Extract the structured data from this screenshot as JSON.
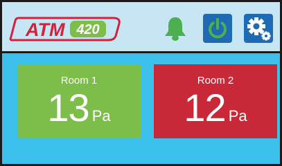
{
  "header": {
    "logo": {
      "brand": "ATM",
      "model": "420"
    },
    "buttons": [
      {
        "icon": "bell-icon",
        "color": "#4caf50"
      },
      {
        "icon": "power-icon",
        "color": "#1e6ab3"
      },
      {
        "icon": "gear-icon",
        "color": "#1e6ab3"
      }
    ]
  },
  "rooms": [
    {
      "name": "Room 1",
      "value": "13",
      "unit": "Pa",
      "color": "#7dbd4a"
    },
    {
      "name": "Room 2",
      "value": "12",
      "unit": "Pa",
      "color": "#c92838"
    }
  ],
  "colors": {
    "header_bg": "#c6e6f3",
    "main_bg": "#3cc0ec",
    "logo_red": "#d3213c",
    "logo_green": "#7dbd4a"
  }
}
